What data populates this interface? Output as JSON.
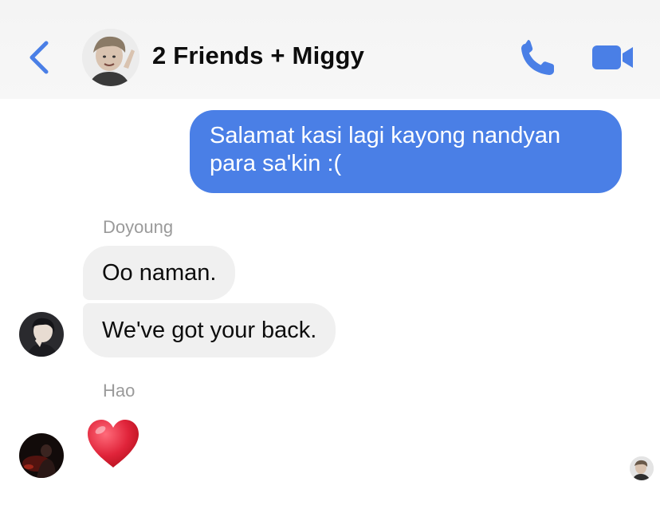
{
  "header": {
    "title": "2 Friends + Miggy",
    "icons": {
      "back": "chevron-left-icon",
      "call": "phone-icon",
      "video": "video-camera-icon"
    },
    "accent_color": "#4a7fe6"
  },
  "messages": {
    "outgoing": {
      "line1": "Salamat kasi lagi kayong nandyan",
      "line2": "para sa'kin :("
    },
    "doyoung": {
      "sender": "Doyoung",
      "message1": "Oo naman.",
      "message2": "We've got your back."
    },
    "hao": {
      "sender": "Hao",
      "reaction": "heart-emoji"
    }
  },
  "colors": {
    "outgoing_bubble": "#4a7fe6",
    "incoming_bubble": "#f0f0f0",
    "sender_label": "#9a9a9a",
    "heart": "#e0243a"
  }
}
